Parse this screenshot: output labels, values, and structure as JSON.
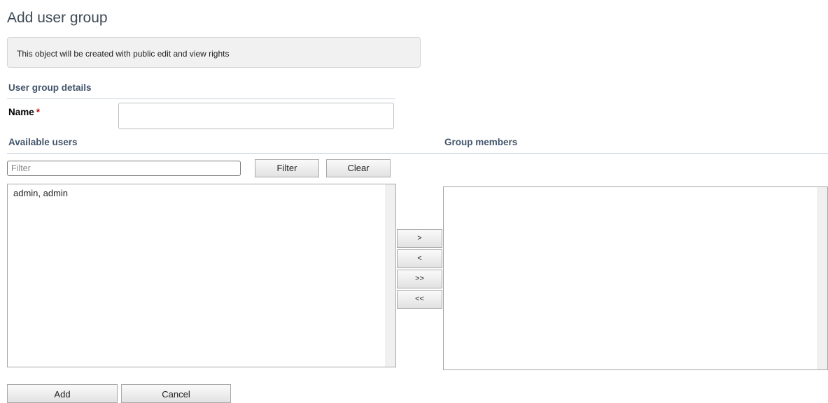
{
  "page": {
    "title": "Add user group"
  },
  "notice": {
    "text": "This object will be created with public edit and view rights"
  },
  "details": {
    "heading": "User group details",
    "name_label": "Name",
    "required_marker": "*",
    "name_value": ""
  },
  "available": {
    "heading": "Available users",
    "filter_placeholder": "Filter",
    "filter_button": "Filter",
    "clear_button": "Clear",
    "items": [
      "admin, admin"
    ]
  },
  "members": {
    "heading": "Group members",
    "items": []
  },
  "transfer": {
    "move_selected_right": ">",
    "move_selected_left": "<",
    "move_all_right": ">>",
    "move_all_left": "<<"
  },
  "actions": {
    "add_button": "Add",
    "cancel_button": "Cancel"
  }
}
